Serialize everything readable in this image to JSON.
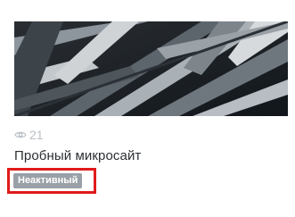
{
  "card": {
    "title": "Пробный микросайт",
    "views": "21",
    "views_icon": "eye-icon",
    "status": "Неактивный",
    "status_color": "#9aa0a7",
    "highlight_color": "#e01b1b"
  }
}
